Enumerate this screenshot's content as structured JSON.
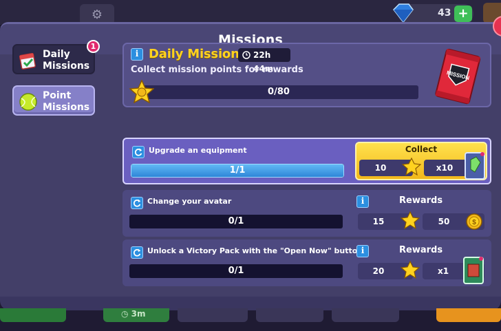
{
  "top": {
    "gem_count": "43",
    "plus": "+"
  },
  "panel": {
    "title": "Missions"
  },
  "sidebar": {
    "daily_label": "Daily\nMissions",
    "daily_label_line1": "Daily",
    "daily_label_line2": "Missions",
    "daily_badge": "1",
    "point_label_line1": "Point",
    "point_label_line2": "Missions"
  },
  "daily": {
    "title": "Daily Missions",
    "timer": "22h 44m",
    "description": "Collect mission points for rewards",
    "progress_text": "0/80",
    "progress": 0.0,
    "pack_text": "MISSION"
  },
  "missions": [
    {
      "title": "Upgrade an equipment",
      "progress_text": "1/1",
      "progress": 1.0,
      "action_label": "Collect",
      "points": "10",
      "reward_amount": "x10"
    },
    {
      "title": "Change your avatar",
      "progress_text": "0/1",
      "progress": 0.0,
      "rewards_label": "Rewards",
      "points": "15",
      "reward_amount": "50"
    },
    {
      "title": "Unlock a Victory Pack with the \"Open Now\" button",
      "progress_text": "0/1",
      "progress": 0.0,
      "rewards_label": "Rewards",
      "points": "20",
      "reward_amount": "x1"
    }
  ],
  "bottom": {
    "timer": "3m"
  },
  "colors": {
    "panel": "#433f68",
    "accent_yellow": "#ffd21f",
    "progress_blue": "#2e86d8",
    "badge_pink": "#e02a6e"
  },
  "icons": [
    "gear-icon",
    "gem-icon",
    "calendar-icon",
    "tennis-ball-icon",
    "info-icon",
    "clock-icon",
    "star-icon",
    "refresh-icon",
    "coin-icon",
    "card-icon",
    "pack-icon"
  ]
}
